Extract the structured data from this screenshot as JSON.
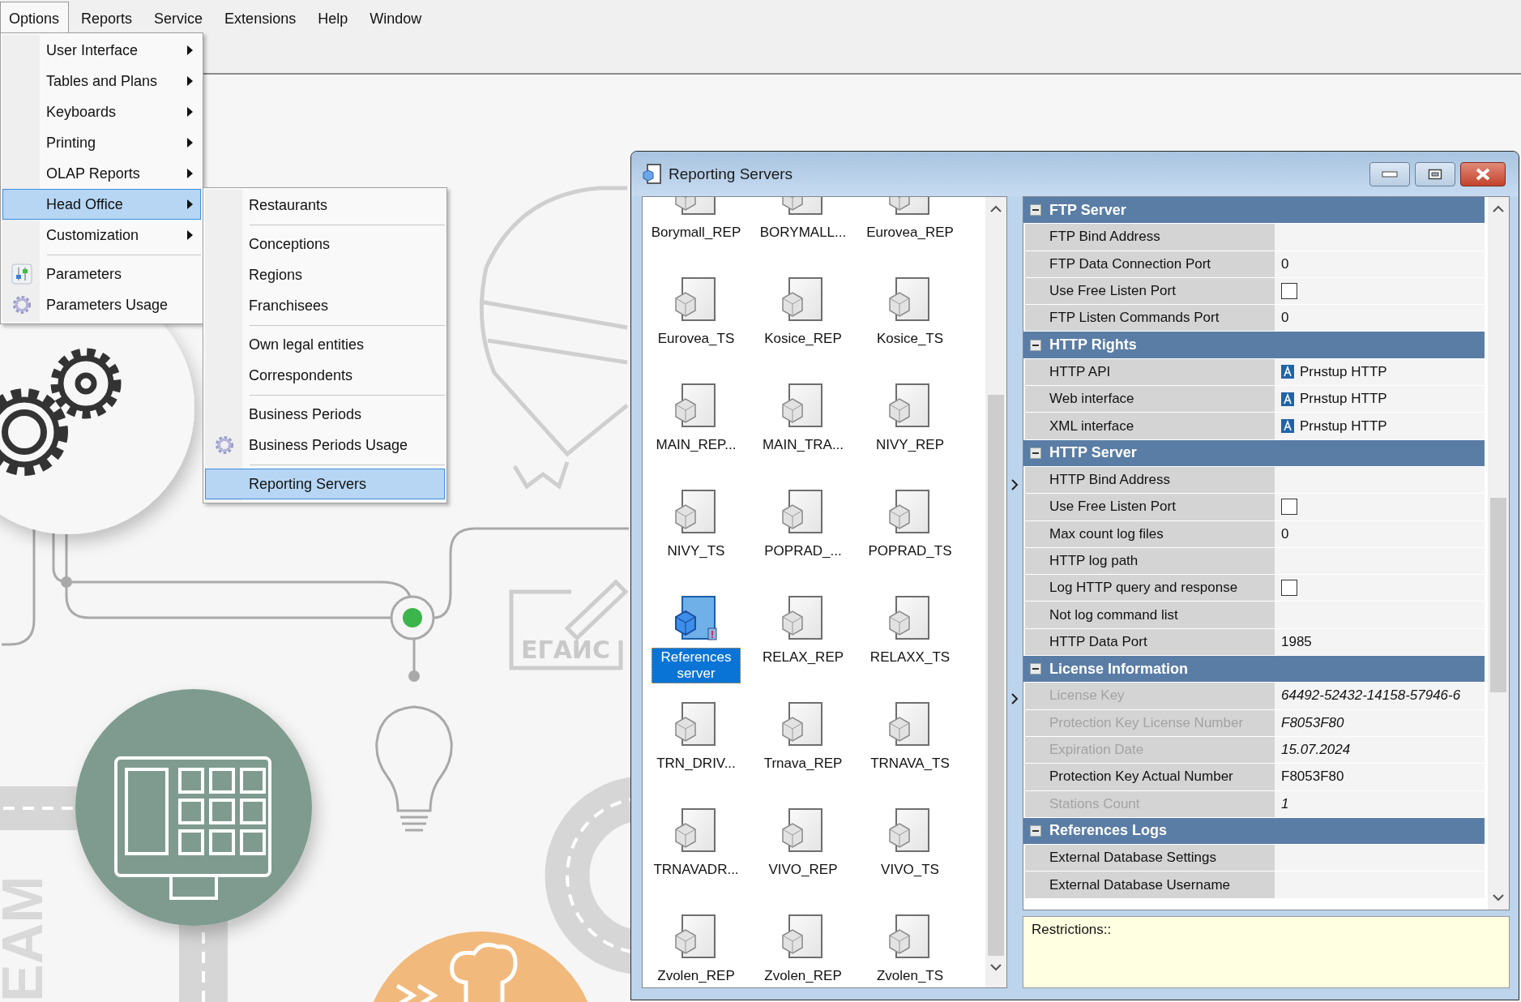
{
  "menubar": [
    {
      "label": "Options",
      "selected": true
    },
    {
      "label": "Reports",
      "selected": false
    },
    {
      "label": "Service",
      "selected": false
    },
    {
      "label": "Extensions",
      "selected": false
    },
    {
      "label": "Help",
      "selected": false
    },
    {
      "label": "Window",
      "selected": false
    }
  ],
  "options_menu": [
    {
      "kind": "submenu",
      "label": "User Interface",
      "selected": false
    },
    {
      "kind": "submenu",
      "label": "Tables and Plans",
      "selected": false
    },
    {
      "kind": "submenu",
      "label": "Keyboards",
      "selected": false
    },
    {
      "kind": "submenu",
      "label": "Printing",
      "selected": false
    },
    {
      "kind": "submenu",
      "label": "OLAP Reports",
      "selected": false
    },
    {
      "kind": "submenu",
      "label": "Head Office",
      "selected": true
    },
    {
      "kind": "submenu",
      "label": "Customization",
      "selected": false
    },
    {
      "kind": "separator"
    },
    {
      "kind": "settings",
      "label": "Parameters",
      "selected": false
    },
    {
      "kind": "usage",
      "label": "Parameters Usage",
      "selected": false
    }
  ],
  "head_office_menu": [
    {
      "kind": "command",
      "label": "Restaurants",
      "selected": false
    },
    {
      "kind": "separator"
    },
    {
      "kind": "command",
      "label": "Conceptions",
      "selected": false
    },
    {
      "kind": "command",
      "label": "Regions",
      "selected": false
    },
    {
      "kind": "command",
      "label": "Franchisees",
      "selected": false
    },
    {
      "kind": "separator"
    },
    {
      "kind": "command",
      "label": "Own legal entities",
      "selected": false
    },
    {
      "kind": "command",
      "label": "Correspondents",
      "selected": false
    },
    {
      "kind": "separator"
    },
    {
      "kind": "command",
      "label": "Business Periods",
      "selected": false
    },
    {
      "kind": "usage",
      "label": "Business Periods Usage",
      "selected": false
    },
    {
      "kind": "separator"
    },
    {
      "kind": "command",
      "label": "Reporting Servers",
      "selected": true
    }
  ],
  "window": {
    "title": "Reporting Servers"
  },
  "servers": [
    {
      "name": "Borymall_REP",
      "kind": "server",
      "selected": false
    },
    {
      "name": "BORYMALL...",
      "kind": "server",
      "selected": false
    },
    {
      "name": "Eurovea_REP",
      "kind": "server",
      "selected": false
    },
    {
      "name": "Eurovea_TS",
      "kind": "server",
      "selected": false
    },
    {
      "name": "Kosice_REP",
      "kind": "server",
      "selected": false
    },
    {
      "name": "Kosice_TS",
      "kind": "server",
      "selected": false
    },
    {
      "name": "MAIN_REP...",
      "kind": "server",
      "selected": false
    },
    {
      "name": "MAIN_TRA...",
      "kind": "server",
      "selected": false
    },
    {
      "name": "NIVY_REP",
      "kind": "server",
      "selected": false
    },
    {
      "name": "NIVY_TS",
      "kind": "server",
      "selected": false
    },
    {
      "name": "POPRAD_...",
      "kind": "server",
      "selected": false
    },
    {
      "name": "POPRAD_TS",
      "kind": "server",
      "selected": false
    },
    {
      "name": "References server",
      "kind": "references",
      "selected": true
    },
    {
      "name": "RELAX_REP",
      "kind": "server",
      "selected": false
    },
    {
      "name": "RELAXX_TS",
      "kind": "server",
      "selected": false
    },
    {
      "name": "TRN_DRIV...",
      "kind": "server",
      "selected": false
    },
    {
      "name": "Trnava_REP",
      "kind": "server",
      "selected": false
    },
    {
      "name": "TRNAVA_TS",
      "kind": "server",
      "selected": false
    },
    {
      "name": "TRNAVADR...",
      "kind": "server",
      "selected": false
    },
    {
      "name": "VIVO_REP",
      "kind": "server",
      "selected": false
    },
    {
      "name": "VIVO_TS",
      "kind": "server",
      "selected": false
    },
    {
      "name": "Zvolen_REP",
      "kind": "server",
      "selected": false
    },
    {
      "name": "Zvolen_REP",
      "kind": "server",
      "selected": false
    },
    {
      "name": "Zvolen_TS",
      "kind": "server",
      "selected": false
    }
  ],
  "properties": [
    {
      "title": "FTP Server",
      "expanded": true,
      "rows": [
        {
          "label": "FTP Bind Address",
          "kind": "text",
          "disabled": false
        },
        {
          "label": "FTP Data Connection Port",
          "kind": "text",
          "value": "0",
          "disabled": false
        },
        {
          "label": "Use Free Listen Port",
          "kind": "checkbox",
          "checked": false,
          "disabled": false
        },
        {
          "label": "FTP Listen Commands Port",
          "kind": "text",
          "value": "0",
          "disabled": false
        }
      ]
    },
    {
      "title": "HTTP Rights",
      "expanded": true,
      "rows": [
        {
          "label": "HTTP API",
          "kind": "access",
          "value": "Prнstup HTTP",
          "disabled": false
        },
        {
          "label": "Web interface",
          "kind": "access",
          "value": "Prнstup HTTP",
          "disabled": false
        },
        {
          "label": "XML interface",
          "kind": "access",
          "value": "Prнstup HTTP",
          "disabled": false
        }
      ]
    },
    {
      "title": "HTTP Server",
      "expanded": true,
      "rows": [
        {
          "label": "HTTP Bind Address",
          "kind": "text",
          "disabled": false
        },
        {
          "label": "Use Free Listen Port",
          "kind": "checkbox",
          "checked": false,
          "disabled": false
        },
        {
          "label": "Max count log files",
          "kind": "text",
          "value": "0",
          "disabled": false
        },
        {
          "label": "HTTP log path",
          "kind": "text",
          "disabled": false
        },
        {
          "label": "Log HTTP query and response",
          "kind": "checkbox",
          "checked": false,
          "disabled": false
        },
        {
          "label": "Not log command list",
          "kind": "text",
          "disabled": false
        },
        {
          "label": "HTTP Data Port",
          "kind": "text",
          "value": "1985",
          "disabled": false
        }
      ]
    },
    {
      "title": "License Information",
      "expanded": true,
      "rows": [
        {
          "label": "License Key",
          "kind": "text",
          "value": "64492-52432-14158-57946-6",
          "disabled": true
        },
        {
          "label": "Protection Key License Number",
          "kind": "text",
          "value": "F8053F80",
          "disabled": true
        },
        {
          "label": "Expiration Date",
          "kind": "text",
          "value": "15.07.2024",
          "disabled": true
        },
        {
          "label": "Protection Key Actual Number",
          "kind": "text",
          "value": "F8053F80",
          "disabled": false
        },
        {
          "label": "Stations Count",
          "kind": "text",
          "value": "1",
          "disabled": true
        }
      ]
    },
    {
      "title": "References Logs",
      "expanded": true,
      "rows": [
        {
          "label": "External Database Settings",
          "kind": "text",
          "disabled": false
        },
        {
          "label": "External Database Username",
          "kind": "text",
          "disabled": false
        }
      ]
    }
  ],
  "restrictions": "Restrictions::",
  "background": {
    "sign_label": "ЕГАИС",
    "wall_text": "EAM"
  }
}
